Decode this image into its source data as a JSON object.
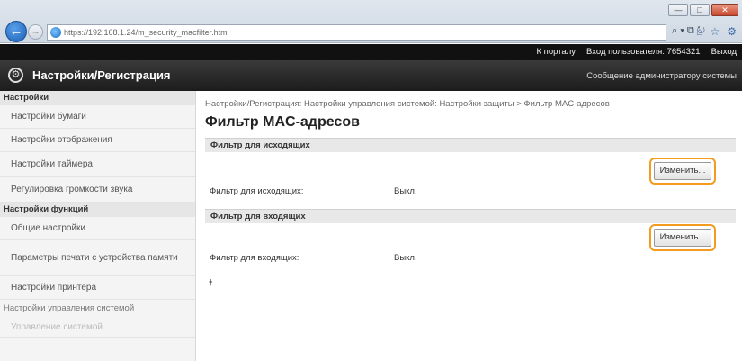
{
  "browser": {
    "url": "https://192.168.1.24/m_security_macfilter.html",
    "win_minimize": "—",
    "win_maximize": "□",
    "win_close": "✕",
    "addr_tools": "⌕ ▾ ⧉ ↻",
    "nav_icons": [
      "⌂",
      "☆",
      "⚙"
    ]
  },
  "topbar": {
    "portal_link": "К порталу",
    "login_label": "Вход пользователя:",
    "login_value": "7654321",
    "logout_link": "Выход"
  },
  "header": {
    "gear_icon": "⚙",
    "title": "Настройки/Регистрация",
    "message_link": "Сообщение администратору системы"
  },
  "sidebar": {
    "section1": "Настройки",
    "items1": [
      "Настройки бумаги",
      "Настройки отображения",
      "Настройки таймера",
      "Регулировка громкости звука"
    ],
    "section2": "Настройки функций",
    "items2": [
      "Общие настройки",
      "Параметры печати с устройства памяти",
      "Настройки принтера"
    ],
    "section3": "Настройки управления системой",
    "items3": [
      "Управление системой"
    ]
  },
  "main": {
    "breadcrumb": "Настройки/Регистрация: Настройки управления системой: Настройки защиты > Фильтр MAC-адресов",
    "title": "Фильтр MAC-адресов",
    "outgoing": {
      "section": "Фильтр для исходящих",
      "button": "Изменить...",
      "label": "Фильтр для исходящих:",
      "value": "Выкл."
    },
    "incoming": {
      "section": "Фильтр для входящих",
      "button": "Изменить...",
      "label": "Фильтр для входящих:",
      "value": "Выкл."
    },
    "top_arrow": "⯒"
  },
  "colors": {
    "highlight": "#f39c1f",
    "titlebar": "#2a2a2a"
  }
}
